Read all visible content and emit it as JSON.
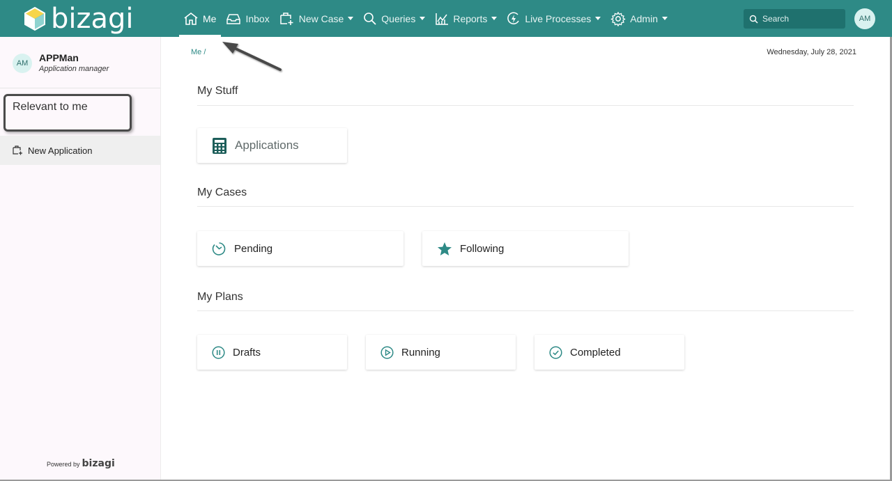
{
  "brand": {
    "logo_text": "bizagi",
    "color": "#2e8a86"
  },
  "nav": {
    "items": [
      {
        "label": "Me",
        "icon": "home-icon",
        "active": true,
        "dropdown": false
      },
      {
        "label": "Inbox",
        "icon": "inbox-icon",
        "active": false,
        "dropdown": false
      },
      {
        "label": "New Case",
        "icon": "new-case-icon",
        "active": false,
        "dropdown": true
      },
      {
        "label": "Queries",
        "icon": "search-icon",
        "active": false,
        "dropdown": true
      },
      {
        "label": "Reports",
        "icon": "chart-icon",
        "active": false,
        "dropdown": true
      },
      {
        "label": "Live Processes",
        "icon": "lightning-icon",
        "active": false,
        "dropdown": true
      },
      {
        "label": "Admin",
        "icon": "gear-icon",
        "active": false,
        "dropdown": true
      }
    ],
    "search_placeholder": "Search",
    "avatar_initials": "AM"
  },
  "sidebar": {
    "user": {
      "initials": "AM",
      "name": "APPMan",
      "role": "Application manager"
    },
    "section_title": "Relevant to me",
    "items": [
      {
        "label": "New Application",
        "icon": "new-application-icon"
      }
    ],
    "powered_by": "Powered by",
    "powered_logo": "bizagi"
  },
  "main": {
    "breadcrumb": "Me /",
    "date": "Wednesday, July 28, 2021",
    "sections": [
      {
        "title": "My Stuff",
        "cards": [
          {
            "label": "Applications",
            "icon": "calculator-icon"
          }
        ]
      },
      {
        "title": "My Cases",
        "cards": [
          {
            "label": "Pending",
            "icon": "clock-icon"
          },
          {
            "label": "Following",
            "icon": "star-icon"
          }
        ]
      },
      {
        "title": "My Plans",
        "cards": [
          {
            "label": "Drafts",
            "icon": "pause-circle-icon"
          },
          {
            "label": "Running",
            "icon": "play-circle-icon"
          },
          {
            "label": "Completed",
            "icon": "check-circle-icon"
          }
        ]
      }
    ]
  }
}
